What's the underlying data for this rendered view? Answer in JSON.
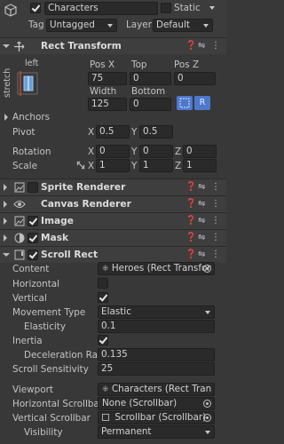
{
  "gameobject": {
    "name": "Characters",
    "static_label": "Static",
    "tag_label": "Tag",
    "tag_value": "Untagged",
    "layer_label": "Layer",
    "layer_value": "Default"
  },
  "rect_transform": {
    "title": "Rect Transform",
    "anchor_h": "left",
    "anchor_v": "stretch",
    "col1": "Pos X",
    "col2": "Top",
    "col3": "Pos Z",
    "pos_x": "75",
    "top": "0",
    "pos_z": "0",
    "col4": "Width",
    "col5": "Bottom",
    "width": "125",
    "bottom": "0",
    "r_button": "R",
    "anchors_label": "Anchors",
    "pivot_label": "Pivot",
    "pivot_x": "0.5",
    "pivot_y": "0.5",
    "rotation_label": "Rotation",
    "rot_x": "0",
    "rot_y": "0",
    "rot_z": "0",
    "scale_label": "Scale",
    "scale_x": "1",
    "scale_y": "1",
    "scale_z": "1",
    "axis_x": "X",
    "axis_y": "Y",
    "axis_z": "Z"
  },
  "components": [
    {
      "title": "Sprite Renderer"
    },
    {
      "title": "Canvas Renderer"
    },
    {
      "title": "Image"
    },
    {
      "title": "Mask"
    },
    {
      "title": "Scroll Rect"
    }
  ],
  "scroll_rect": {
    "content_label": "Content",
    "content_value": "Heroes (Rect Transfor",
    "horizontal_label": "Horizontal",
    "horizontal_checked": false,
    "vertical_label": "Vertical",
    "vertical_checked": true,
    "movement_label": "Movement Type",
    "movement_value": "Elastic",
    "elasticity_label": "Elasticity",
    "elasticity_value": "0.1",
    "inertia_label": "Inertia",
    "inertia_checked": true,
    "decel_label": "Deceleration Rate",
    "decel_value": "0.135",
    "sensitivity_label": "Scroll Sensitivity",
    "sensitivity_value": "25",
    "viewport_label": "Viewport",
    "viewport_value": "Characters (Rect Tran",
    "hscroll_label": "Horizontal Scrollbar",
    "hscroll_value": "None (Scrollbar)",
    "vscroll_label": "Vertical Scrollbar",
    "vscroll_value": "Scrollbar (Scrollbar)",
    "visibility_label": "Visibility",
    "visibility_value": "Permanent"
  },
  "colors": {
    "background": "#383838",
    "header": "#3e3e3e",
    "field": "#2a2a2a",
    "accent": "#4d78cc"
  }
}
